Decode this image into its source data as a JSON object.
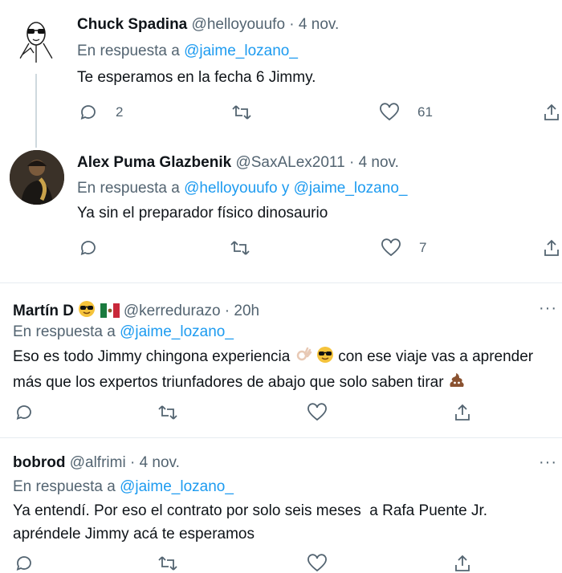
{
  "tweets": [
    {
      "name": "Chuck Spadina",
      "handle": "@helloyouufo",
      "separator": "·",
      "time": "4 nov.",
      "reply_prefix": "En respuesta a",
      "reply_to_1": "@jaime_lozano_",
      "text": "Te esperamos en la fecha 6 Jimmy.",
      "replies": "2",
      "retweets": "",
      "likes": "61"
    },
    {
      "name": "Alex Puma Glazbenik",
      "handle": "@SaxALex2011",
      "separator": "·",
      "time": "4 nov.",
      "reply_prefix": "En respuesta a",
      "reply_to_1": "@helloyouufo",
      "reply_joiner": "y",
      "reply_to_2": "@jaime_lozano_",
      "text": "Ya sin el preparador físico dinosaurio",
      "replies": "",
      "retweets": "",
      "likes": "7"
    },
    {
      "name": "Martín D",
      "handle": "@kerredurazo",
      "separator": "·",
      "time": "20h",
      "reply_prefix": "En respuesta a",
      "reply_to_1": "@jaime_lozano_",
      "text_line1": "Eso es todo Jimmy chingona experiencia",
      "text_line1_tail": "con ese viaje vas a aprender",
      "text_line2": "más que los expertos triunfadores de abajo que solo saben tirar",
      "more": "···"
    },
    {
      "name": "bobrod",
      "handle": "@alfrimi",
      "separator": "·",
      "time": "4 nov.",
      "reply_prefix": "En respuesta a",
      "reply_to_1": "@jaime_lozano_",
      "text_line1": "Ya entendí. Por eso el contrato por solo seis meses  a Rafa Puente Jr.",
      "text_line2": "apréndele Jimmy acá te esperamos",
      "more": "···"
    }
  ],
  "icons": [
    "reply-icon",
    "retweet-icon",
    "like-icon",
    "share-icon",
    "more-icon"
  ],
  "colors": {
    "link": "#1d9bf0",
    "muted": "#536471",
    "text": "#0f1419",
    "divider": "#e6ecf0"
  }
}
